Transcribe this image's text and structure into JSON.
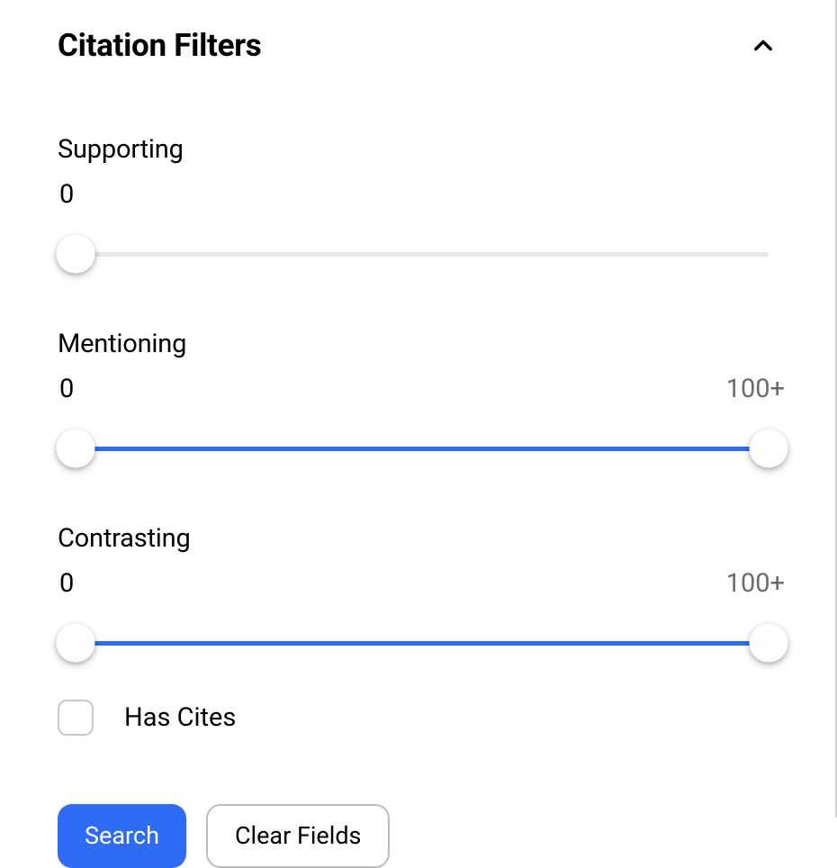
{
  "header": {
    "title": "Citation Filters"
  },
  "sliders": {
    "supporting": {
      "label": "Supporting",
      "min_value": "0",
      "max_value": "",
      "min_pos": 0,
      "max_pos": null
    },
    "mentioning": {
      "label": "Mentioning",
      "min_value": "0",
      "max_value": "100+",
      "min_pos": 0,
      "max_pos": 100
    },
    "contrasting": {
      "label": "Contrasting",
      "min_value": "0",
      "max_value": "100+",
      "min_pos": 0,
      "max_pos": 100
    }
  },
  "checkbox": {
    "has_cites_label": "Has Cites",
    "checked": false
  },
  "buttons": {
    "search": "Search",
    "clear": "Clear Fields"
  }
}
